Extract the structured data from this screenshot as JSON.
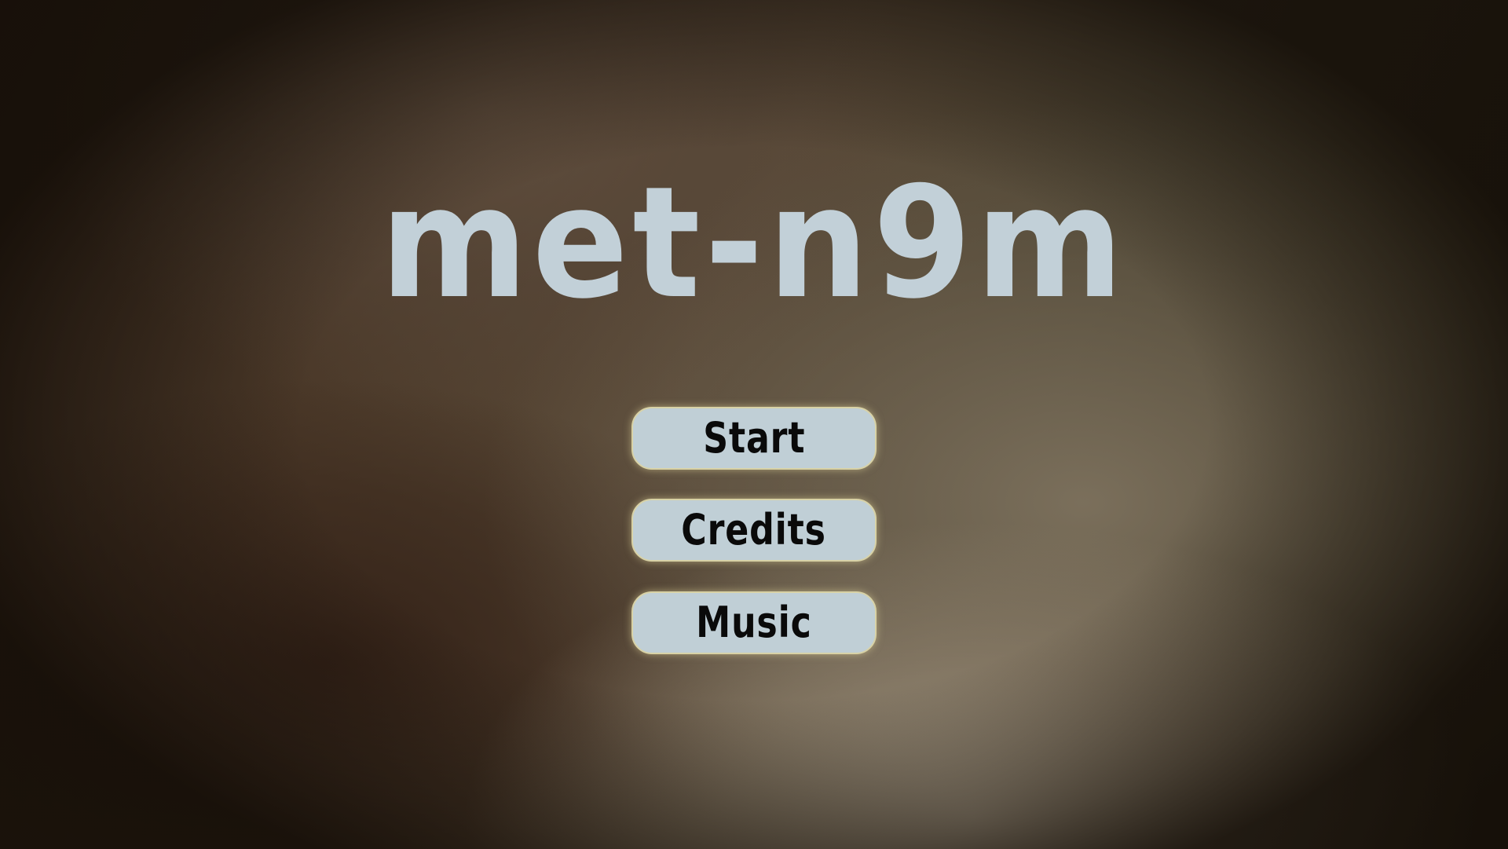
{
  "game": {
    "title": "met-n9m"
  },
  "menu": {
    "items": [
      {
        "label": "Start"
      },
      {
        "label": "Credits"
      },
      {
        "label": "Music"
      }
    ]
  },
  "colors": {
    "title": "#c2d0d8",
    "button_fill": "#c0cfd6",
    "button_glow": "#e8dca0",
    "button_text": "#0a0a0a"
  }
}
